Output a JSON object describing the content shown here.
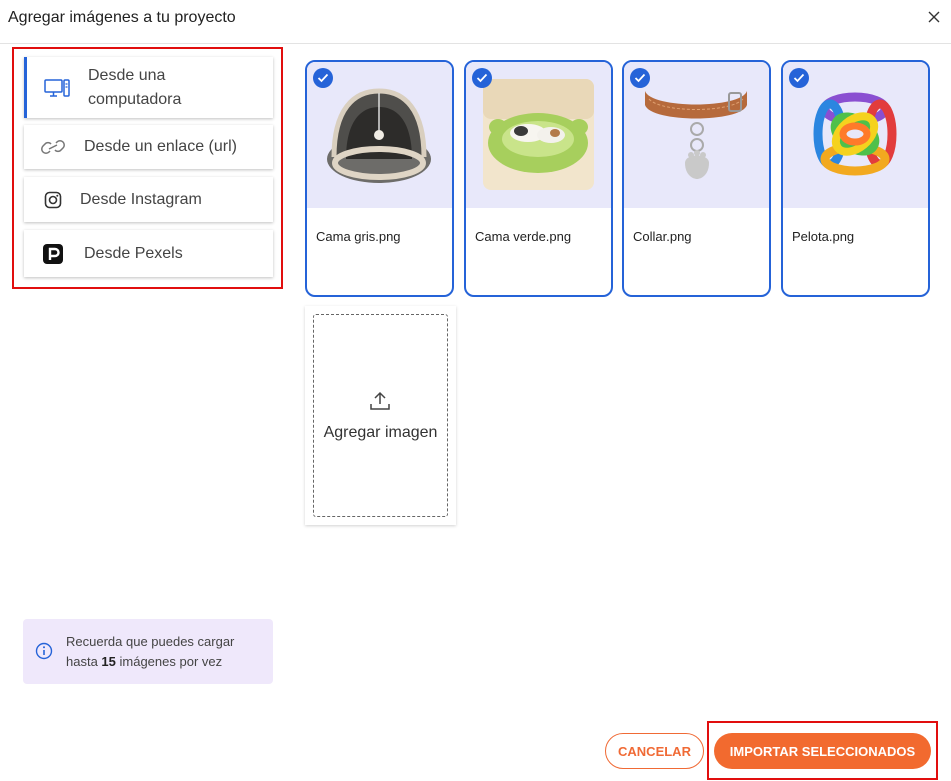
{
  "dialog": {
    "title": "Agregar imágenes a tu proyecto",
    "close_icon": "close-icon"
  },
  "sources": {
    "items": [
      {
        "label": "Desde una computadora",
        "icon": "computer-icon",
        "active": true
      },
      {
        "label": "Desde un enlace (url)",
        "icon": "link-icon",
        "active": false
      },
      {
        "label": "Desde Instagram",
        "icon": "instagram-icon",
        "active": false
      },
      {
        "label": "Desde Pexels",
        "icon": "pexels-icon",
        "active": false
      }
    ]
  },
  "images": [
    {
      "name": "Cama gris.png",
      "selected": true
    },
    {
      "name": "Cama verde.png",
      "selected": true
    },
    {
      "name": "Collar.png",
      "selected": true
    },
    {
      "name": "Pelota.png",
      "selected": true
    }
  ],
  "add_image": {
    "label": "Agregar imagen",
    "icon": "upload-icon"
  },
  "info": {
    "text_before": "Recuerda que puedes cargar hasta ",
    "count": "15",
    "text_after": " imágenes por vez",
    "icon": "info-icon"
  },
  "actions": {
    "cancel_label": "CANCELAR",
    "import_label": "IMPORTAR SELECCIONADOS"
  },
  "colors": {
    "accent": "#2563d8",
    "primary": "#f26a2f",
    "thumb_bg": "#e8e8fa",
    "info_bg": "#efe8fb",
    "highlight": "#e10e0e"
  }
}
